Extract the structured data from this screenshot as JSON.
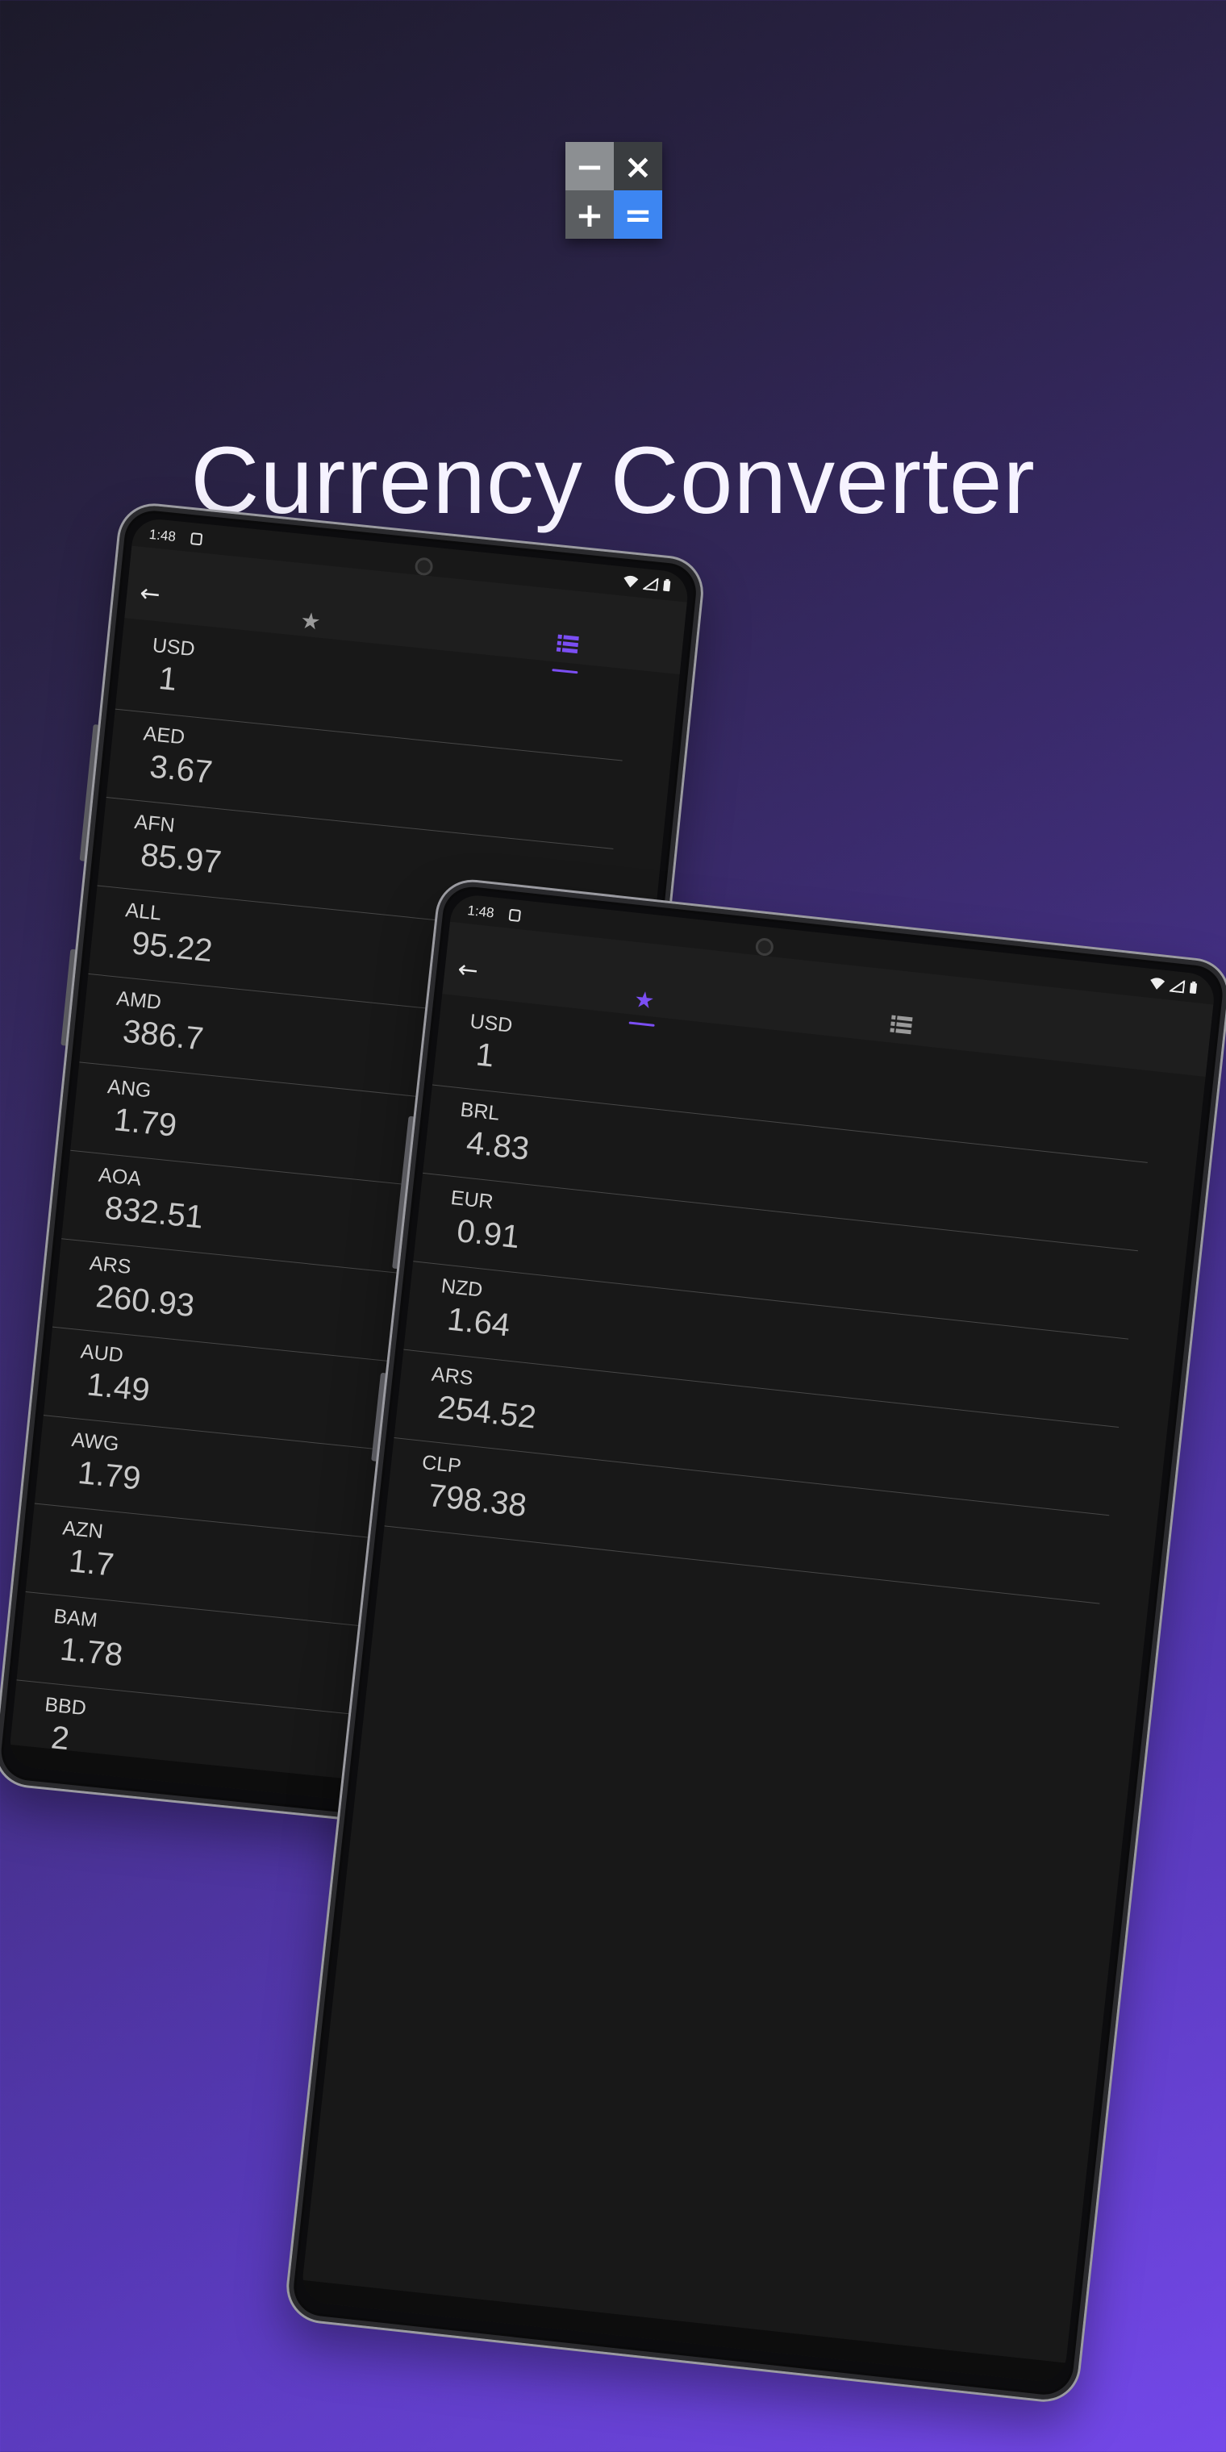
{
  "header": {
    "title": "Currency Converter"
  },
  "app_icon": {
    "minus": "−",
    "times": "×",
    "plus": "+",
    "equals": "="
  },
  "colors": {
    "accent": "#7b4ef3",
    "screen_bg": "#181818",
    "divider": "#474747"
  },
  "phone_all": {
    "status_time": "1:48",
    "active_tab": "all-currencies",
    "rows": [
      {
        "code": "USD",
        "value": "1"
      },
      {
        "code": "AED",
        "value": "3.67"
      },
      {
        "code": "AFN",
        "value": "85.97"
      },
      {
        "code": "ALL",
        "value": "95.22"
      },
      {
        "code": "AMD",
        "value": "386.7"
      },
      {
        "code": "ANG",
        "value": "1.79"
      },
      {
        "code": "AOA",
        "value": "832.51"
      },
      {
        "code": "ARS",
        "value": "260.93"
      },
      {
        "code": "AUD",
        "value": "1.49"
      },
      {
        "code": "AWG",
        "value": "1.79"
      },
      {
        "code": "AZN",
        "value": "1.7"
      },
      {
        "code": "BAM",
        "value": "1.78"
      },
      {
        "code": "BBD",
        "value": "2"
      }
    ]
  },
  "phone_favorites": {
    "status_time": "1:48",
    "active_tab": "favorites",
    "rows": [
      {
        "code": "USD",
        "value": "1"
      },
      {
        "code": "BRL",
        "value": "4.83"
      },
      {
        "code": "EUR",
        "value": "0.91"
      },
      {
        "code": "NZD",
        "value": "1.64"
      },
      {
        "code": "ARS",
        "value": "254.52"
      },
      {
        "code": "CLP",
        "value": "798.38"
      }
    ]
  },
  "icons": {
    "back": "arrow-left-icon",
    "favorites_tab": "star-icon",
    "all_tab": "list-icon",
    "wifi": "wifi-icon",
    "signal": "signal-icon",
    "battery": "battery-icon"
  }
}
